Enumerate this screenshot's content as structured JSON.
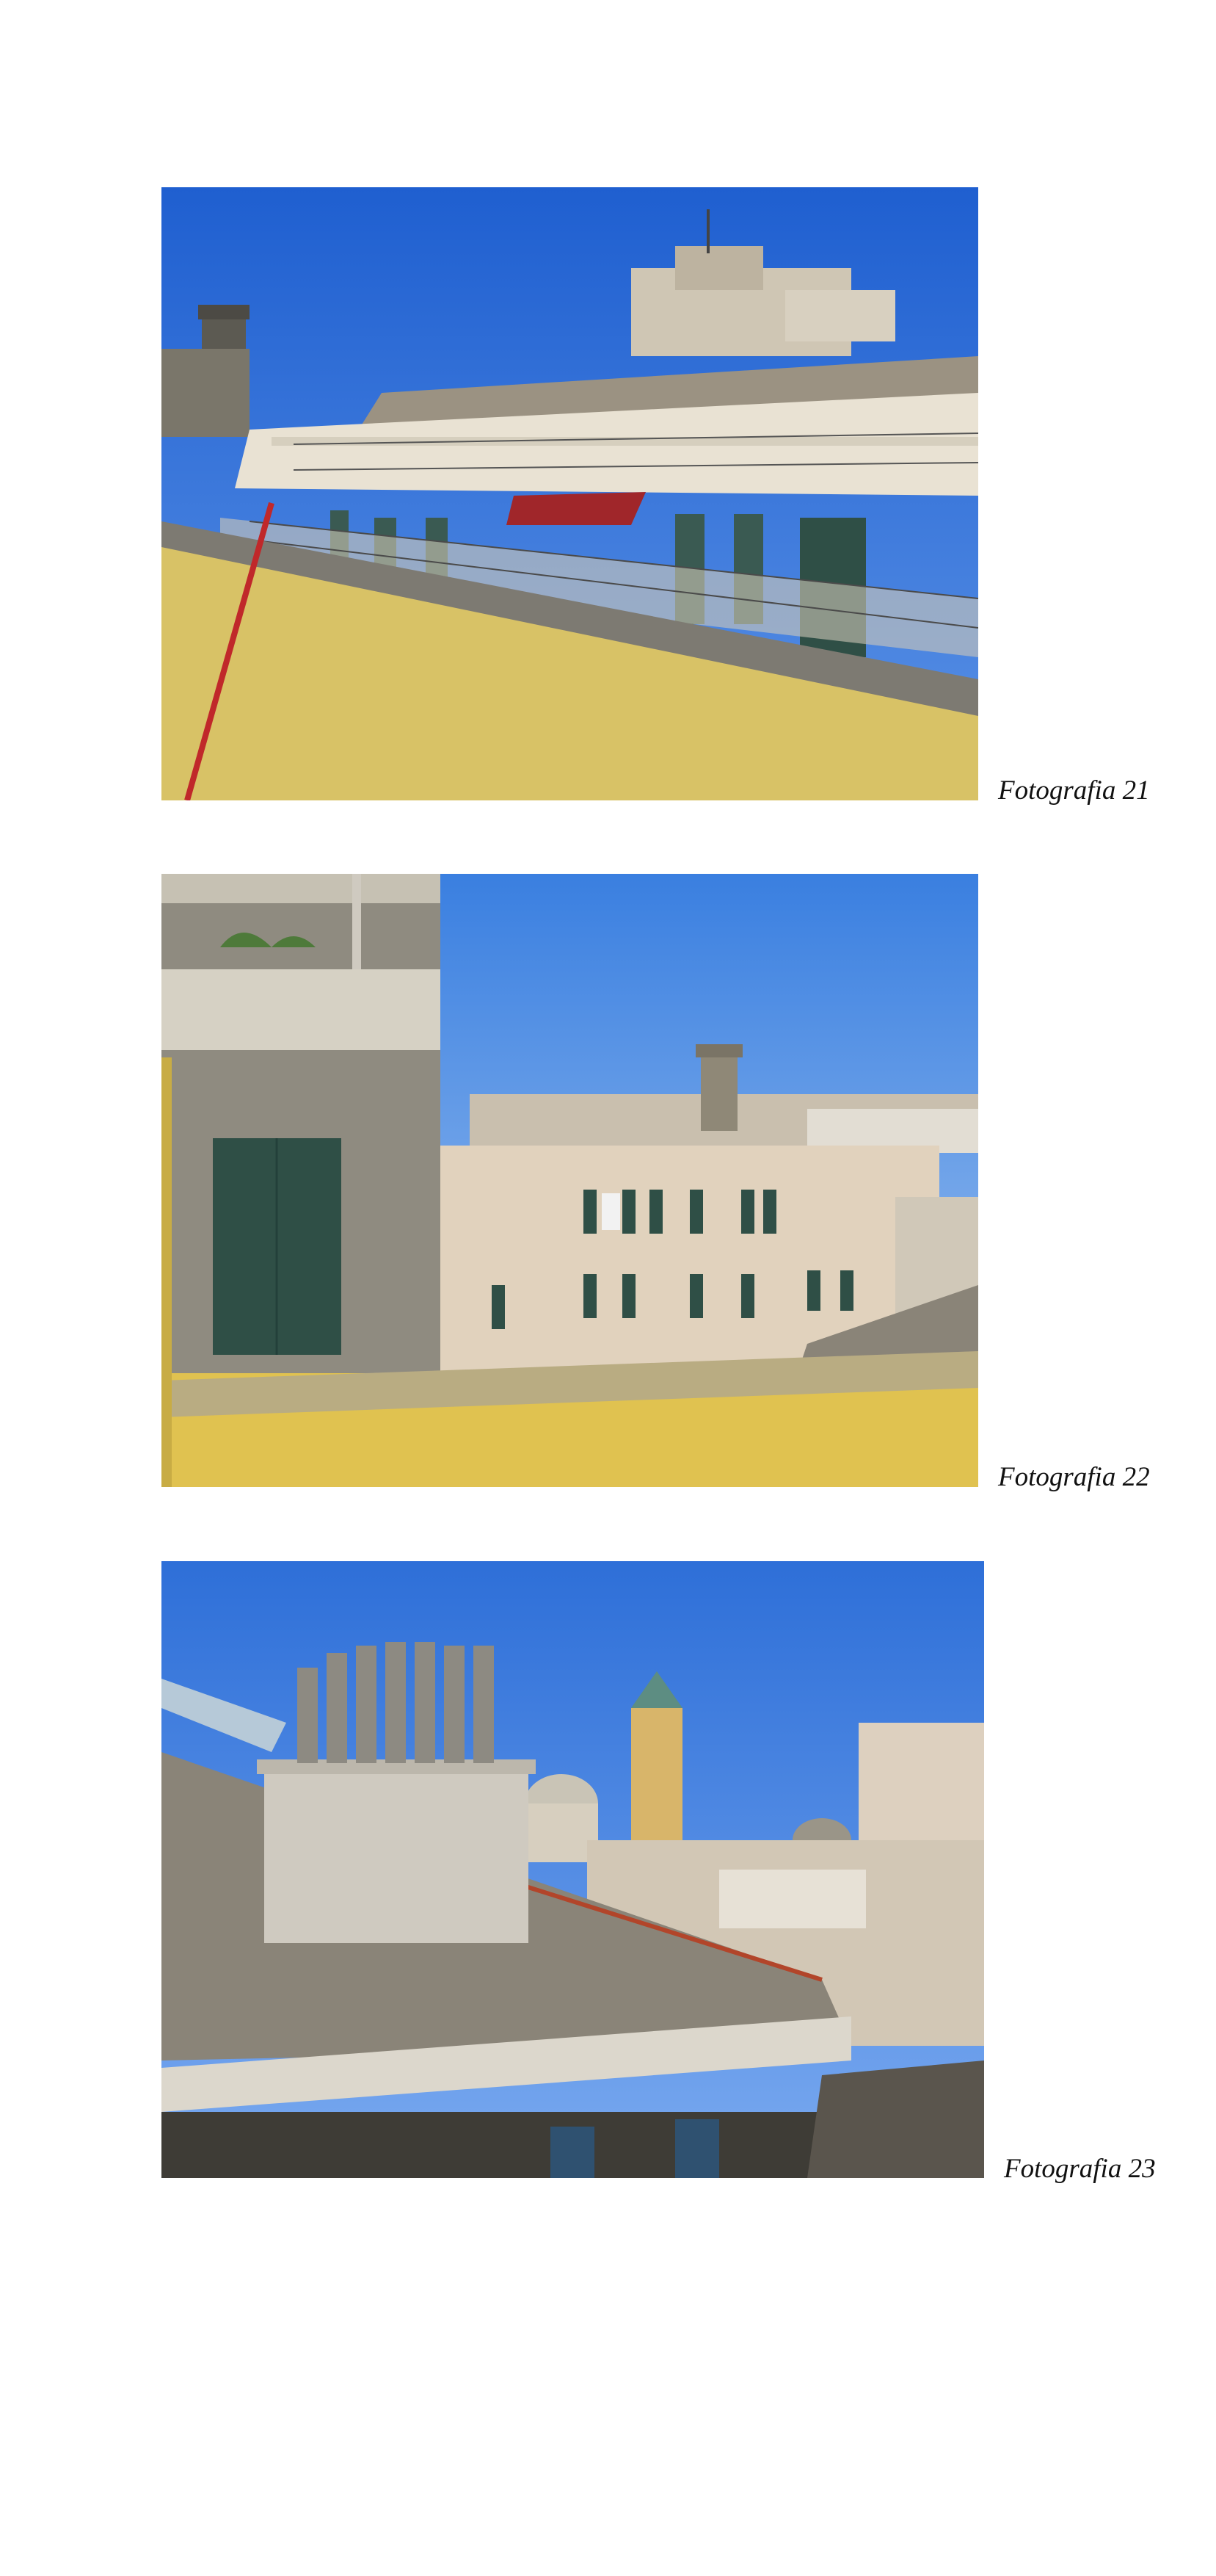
{
  "photos": [
    {
      "caption": "Fotografia 21",
      "image": "rooftop-terraces-with-tower-photo"
    },
    {
      "caption": "Fotografia 22",
      "image": "courtyard-buildings-and-tower-photo"
    },
    {
      "caption": "Fotografia 23",
      "image": "chimneys-and-church-domes-photo"
    }
  ],
  "colors": {
    "sky": "#2f6fd6",
    "parapet": "#d8c266",
    "building": "#e6dccb",
    "shutter": "#2f4f46",
    "roof": "#8a8478"
  }
}
